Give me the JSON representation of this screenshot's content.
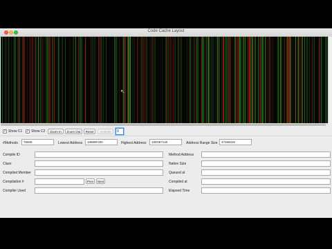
{
  "window": {
    "title": "Code Cache Layout"
  },
  "toolbar": {
    "show_c1_label": "Show C1",
    "show_c2_label": "Show C2",
    "show_c1_checked": "✓",
    "show_c2_checked": "✓",
    "zoom_in_label": "Zoom In",
    "zoom_out_label": "Zoom Out",
    "reset_label": "Reset",
    "animate_label": "Animate",
    "index_value": "0"
  },
  "stats": {
    "methods_label": "#Methods",
    "methods_value": "76805",
    "lowest_label": "Lowest Address",
    "lowest_value": "10889F400",
    "highest_label": "Highest Address",
    "highest_value": "10D067140",
    "range_label": "Address Range Size",
    "range_value": "47466026"
  },
  "details": {
    "compile_id_label": "Compile ID",
    "class_label": "Class",
    "compiled_member_label": "Compiled Member",
    "compilation_label": "Compilation #",
    "compiler_used_label": "Compiler Used",
    "prev_label": "Prev",
    "next_label": "Next",
    "method_address_label": "Method Address",
    "native_size_label": "Native Size",
    "queued_at_label": "Queued at",
    "compiled_at_label": "Compiled at",
    "elapsed_time_label": "Elapsed Time"
  },
  "colors": {
    "c1": "#3a8a2a",
    "c2": "#7a2a1a",
    "background": "#050505"
  }
}
